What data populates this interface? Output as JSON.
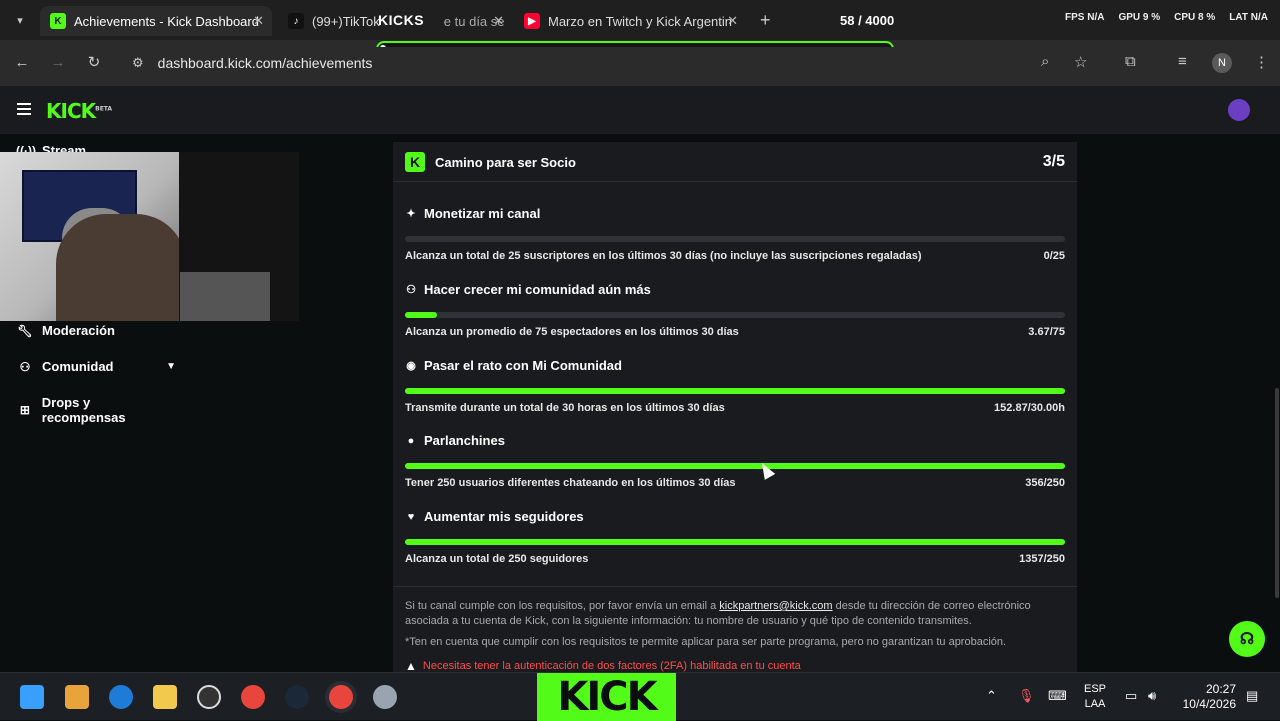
{
  "browser": {
    "tabs": [
      {
        "label": "Achievements - Kick Dashboard",
        "active": true
      },
      {
        "label": "(99+)TikTok",
        "active": false
      },
      {
        "label": "Marzo en Twitch y Kick Argentin",
        "active": false
      }
    ],
    "tab2_suffix": "e tu día se",
    "overlay_kicks": "KICKS",
    "counter": "58 / 4000",
    "sysstats": {
      "fps_label": "FPS",
      "fps_value": "N/A",
      "gpu_label": "GPU",
      "gpu_value": "9 %",
      "cpu_label": "CPU",
      "cpu_value": "8 %",
      "lat_label": "LAT",
      "lat_value": "N/A"
    },
    "url": "dashboard.kick.com/achievements",
    "profile_initial": "N"
  },
  "kick": {
    "logo": "KICK",
    "logo_badge": "BETA"
  },
  "sidebar": {
    "items": [
      {
        "label": "Stream",
        "icon": "broadcast-icon"
      },
      {
        "label": "Moderación",
        "icon": "wrench-icon"
      },
      {
        "label": "Comunidad",
        "icon": "users-icon",
        "expandable": true
      },
      {
        "label": "Drops y recompensas",
        "icon": "gift-icon"
      }
    ]
  },
  "card": {
    "title": "Camino para ser Socio",
    "score": "3/5",
    "goals": [
      {
        "title": "Monetizar mi canal",
        "icon": "sparkle-icon",
        "desc": "Alcanza un total de 25 suscriptores en los últimos 30 días (no incluye las suscripciones regaladas)",
        "value": "0/25",
        "progress": 0
      },
      {
        "title": "Hacer crecer mi comunidad aún más",
        "icon": "users-icon",
        "desc": "Alcanza un promedio de 75 espectadores en los últimos 30 días",
        "value": "3.67/75",
        "progress": 0.049
      },
      {
        "title": "Pasar el rato con Mi Comunidad",
        "icon": "broadcast-icon",
        "desc": "Transmite durante un total de 30 horas en los últimos 30 días",
        "value": "152.87/30.00h",
        "progress": 1
      },
      {
        "title": "Parlanchines",
        "icon": "chat-icon",
        "desc": "Tener 250 usuarios diferentes chateando en los últimos 30 días",
        "value": "356/250",
        "progress": 1
      },
      {
        "title": "Aumentar mis seguidores",
        "icon": "heart-icon",
        "desc": "Alcanza un total de 250 seguidores",
        "value": "1357/250",
        "progress": 1
      }
    ],
    "footer_pre": "Si tu canal cumple con los requisitos, por favor envía un email a",
    "footer_email": "kickpartners@kick.com",
    "footer_post": "desde tu dirección de correo electrónico asociada a tu cuenta de Kick, con la siguiente información: tu nombre de usuario y qué tipo de contenido transmites.",
    "footer_note": "*Ten en cuenta que cumplir con los requisitos te permite aplicar para ser parte programa, pero no garantizan tu aprobación.",
    "warning": "Necesitas tener la autenticación de dos factores (2FA) habilitada en tu cuenta"
  },
  "taskbar": {
    "kick_banner": "KICK",
    "lang_top": "ESP",
    "lang_bottom": "LAA",
    "time": "20:27",
    "date": "10/4/2026"
  },
  "colors": {
    "accent": "#53fc18",
    "card_bg": "#191b1f",
    "warning": "#ff4d4d"
  }
}
